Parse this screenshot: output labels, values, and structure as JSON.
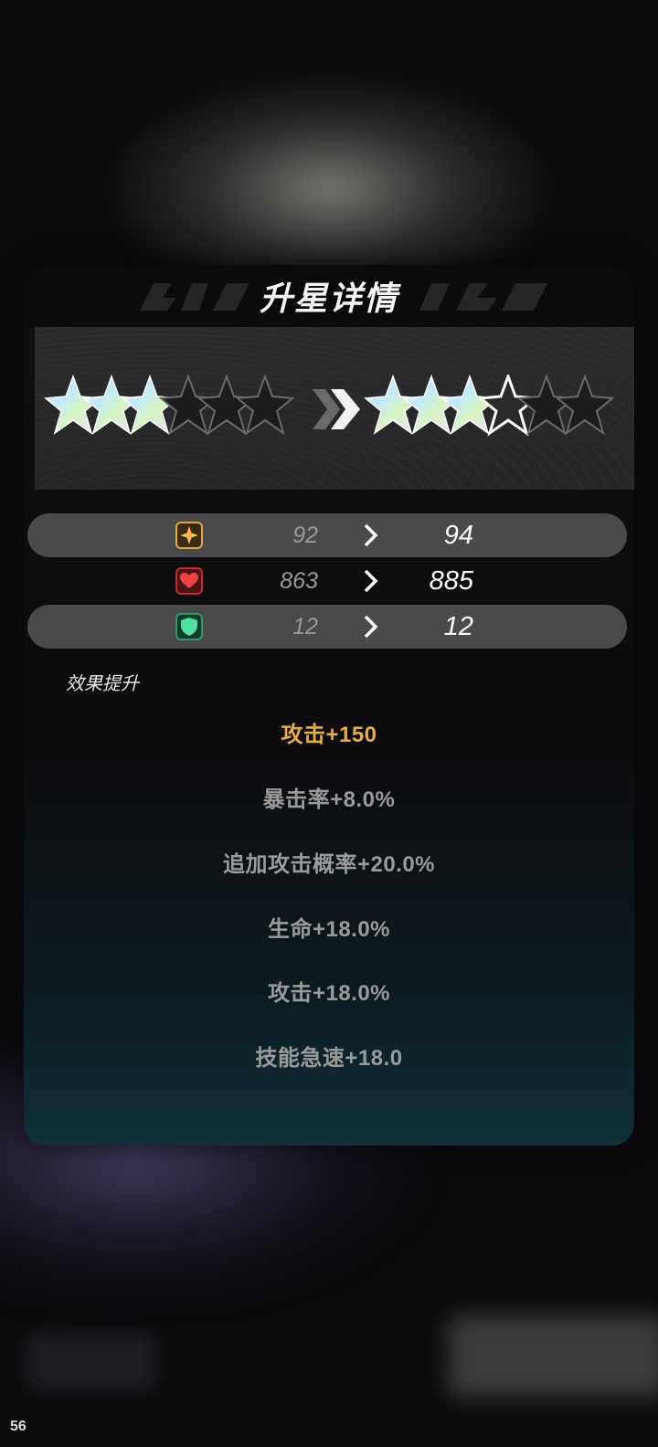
{
  "panel": {
    "title": "升星详情",
    "current_stars": 3,
    "next_stars": 4,
    "max_stars": 6
  },
  "stats": [
    {
      "icon": "attack-star-icon",
      "old": "92",
      "new": "94",
      "icon_color": "#e6a83a"
    },
    {
      "icon": "health-heart-icon",
      "old": "863",
      "new": "885",
      "icon_color": "#e03a3a"
    },
    {
      "icon": "defense-shield-icon",
      "old": "12",
      "new": "12",
      "icon_color": "#3fcf8a"
    }
  ],
  "effects": {
    "label": "效果提升",
    "items": [
      "攻击+150",
      "暴击率+8.0%",
      "追加攻击概率+20.0%",
      "生命+18.0%",
      "攻击+18.0%",
      "技能急速+18.0"
    ]
  },
  "fps": "56"
}
